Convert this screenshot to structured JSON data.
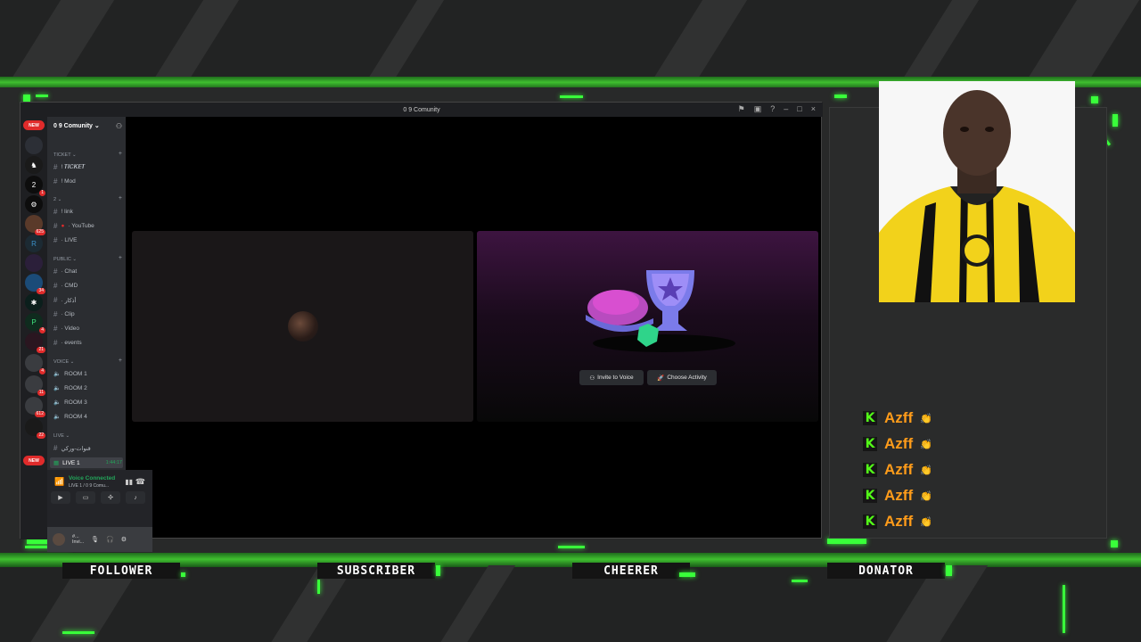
{
  "discord": {
    "window_title": "0 9 Comunity",
    "server_name": "0 9 Comunity",
    "new_badge": "NEW",
    "guild_badges": [
      "1",
      "625",
      "34",
      "4",
      "21",
      "4",
      "11",
      "612",
      "22"
    ],
    "categories": {
      "ticket": "TICKET",
      "two": "2",
      "public": "Public",
      "voice": "VOICE",
      "live": "Live"
    },
    "channels": {
      "ticket": "! 𝑻𝑰𝑪𝑲𝑬𝑻",
      "mod": "! Mod",
      "link": "! link",
      "youtube": "· YouTube",
      "live": "· LIVE",
      "chat": "· Chat",
      "cmd": "· CMD",
      "adkar": "· أذكار",
      "clip": "· Clip",
      "video": "· Video",
      "events": "· events",
      "live_ar": "قنوات-وركي",
      "live1": "LIVE 1"
    },
    "voice_rooms": [
      "ROOM 1",
      "ROOM 2",
      "ROOM 3",
      "ROOM 4"
    ],
    "live1_timer": "1:44:17",
    "voice_status": "Voice Connected",
    "voice_location": "LIVE 1 / 0 9 Comu...",
    "user_name": "#...",
    "user_status": "Invi...",
    "invite_button": "Invite to Voice",
    "activity_button": "Choose Activity"
  },
  "alerts": {
    "rows": [
      {
        "name": "Azff"
      },
      {
        "name": "Azff"
      },
      {
        "name": "Azff"
      },
      {
        "name": "Azff"
      },
      {
        "name": "Azff"
      }
    ],
    "kick_letter": "K"
  },
  "labels": {
    "follower": "FOLLOWER",
    "subscriber": "SUBSCRIBER",
    "cheerer": "CHEERER",
    "donator": "DONATOR"
  },
  "colors": {
    "neon": "#39ff3a",
    "kick_green": "#53fc18",
    "name_orange": "#ff9c1a",
    "discord_green": "#23a55a"
  }
}
